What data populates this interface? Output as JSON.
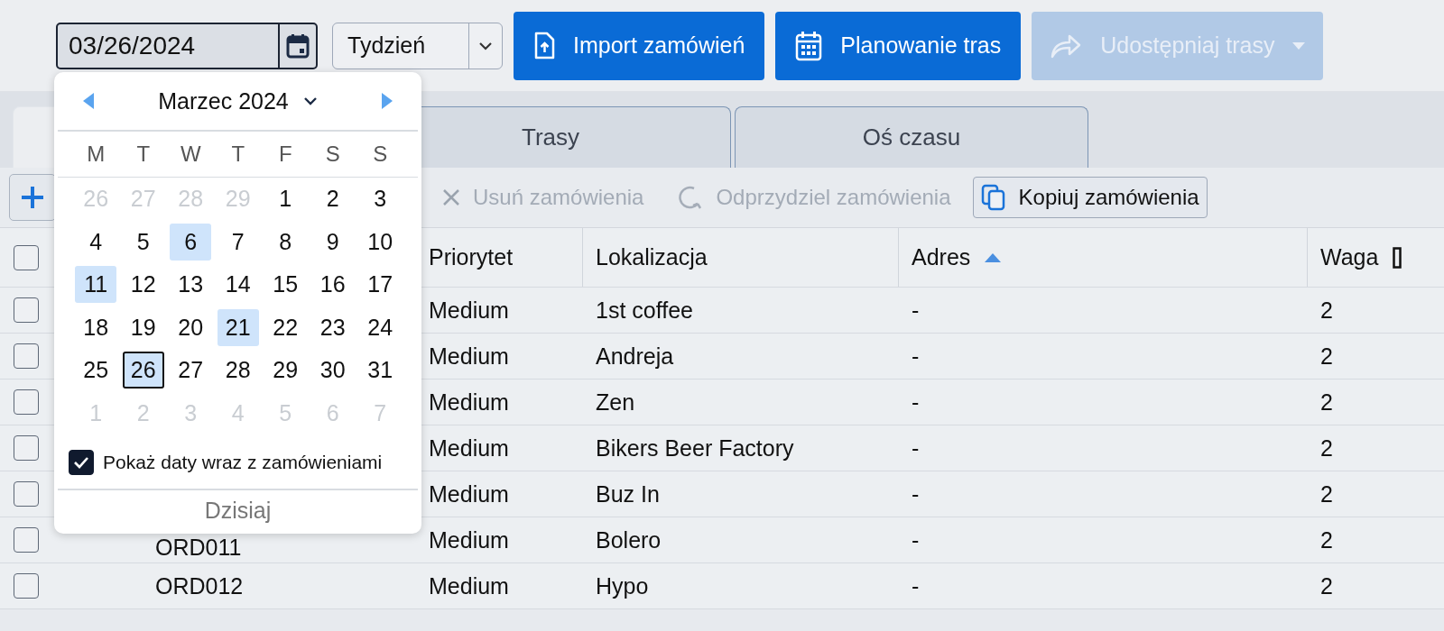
{
  "toolbar": {
    "date_field": {
      "value": "03/26/2024"
    },
    "period_select": {
      "value": "Tydzień"
    },
    "buttons": [
      {
        "label": "Import zamówień",
        "kind": "import",
        "disabled": false
      },
      {
        "label": "Planowanie tras",
        "kind": "plan",
        "disabled": false
      },
      {
        "label": "Udostępniaj trasy",
        "kind": "share",
        "disabled": true
      }
    ]
  },
  "tabs": [
    {
      "selected": true
    },
    {
      "label": "Trasy",
      "selected": false
    },
    {
      "label": "Oś czasu",
      "selected": false
    }
  ],
  "actions": [
    {
      "kind": "add",
      "disabled": false
    },
    {
      "label": "Usuń zamówienia",
      "kind": "delete",
      "disabled": true
    },
    {
      "label": "Odprzydziel zamówienia",
      "kind": "unassign",
      "disabled": true
    },
    {
      "label": "Kopiuj zamówienia",
      "kind": "copy",
      "disabled": false
    }
  ],
  "table": {
    "header_checkbox": {
      "checked": false
    },
    "columns": [
      {
        "label": "Priorytet"
      },
      {
        "label": "Lokalizacja"
      },
      {
        "label": "Adres",
        "sorted": true
      },
      {
        "label": "Waga",
        "unit_icon": true
      }
    ],
    "rows": [
      {
        "checked": false,
        "priority": "Medium",
        "location": "1st coffee",
        "address": "-",
        "weight": "2"
      },
      {
        "checked": false,
        "priority": "Medium",
        "location": "Andreja",
        "address": "-",
        "weight": "2"
      },
      {
        "checked": false,
        "priority": "Medium",
        "location": "Zen",
        "address": "-",
        "weight": "2"
      },
      {
        "checked": false,
        "priority": "Medium",
        "location": "Bikers Beer Factory",
        "address": "-",
        "weight": "2"
      },
      {
        "checked": false,
        "priority": "Medium",
        "location": "Buz In",
        "address": "-",
        "weight": "2"
      },
      {
        "checked": false,
        "id": "ORD011",
        "priority": "Medium",
        "location": "Bolero",
        "address": "-",
        "weight": "2"
      },
      {
        "checked": false,
        "id": "ORD012",
        "priority": "Medium",
        "location": "Hypo",
        "address": "-",
        "weight": "2"
      }
    ]
  },
  "datepicker": {
    "month": "Marzec 2024",
    "weekdays": [
      "M",
      "T",
      "W",
      "T",
      "F",
      "S",
      "S"
    ],
    "weeks": [
      [
        {
          "day": "26",
          "muted": true,
          "has_orders": false,
          "selected": false
        },
        {
          "day": "27",
          "muted": true,
          "has_orders": false,
          "selected": false
        },
        {
          "day": "28",
          "muted": true,
          "has_orders": false,
          "selected": false
        },
        {
          "day": "29",
          "muted": true,
          "has_orders": false,
          "selected": false
        },
        {
          "day": "1",
          "muted": false,
          "has_orders": false,
          "selected": false
        },
        {
          "day": "2",
          "muted": false,
          "has_orders": false,
          "selected": false
        },
        {
          "day": "3",
          "muted": false,
          "has_orders": false,
          "selected": false
        }
      ],
      [
        {
          "day": "4",
          "muted": false,
          "has_orders": false,
          "selected": false
        },
        {
          "day": "5",
          "muted": false,
          "has_orders": false,
          "selected": false
        },
        {
          "day": "6",
          "muted": false,
          "has_orders": true,
          "selected": false
        },
        {
          "day": "7",
          "muted": false,
          "has_orders": false,
          "selected": false
        },
        {
          "day": "8",
          "muted": false,
          "has_orders": false,
          "selected": false
        },
        {
          "day": "9",
          "muted": false,
          "has_orders": false,
          "selected": false
        },
        {
          "day": "10",
          "muted": false,
          "has_orders": false,
          "selected": false
        }
      ],
      [
        {
          "day": "11",
          "muted": false,
          "has_orders": true,
          "selected": false
        },
        {
          "day": "12",
          "muted": false,
          "has_orders": false,
          "selected": false
        },
        {
          "day": "13",
          "muted": false,
          "has_orders": false,
          "selected": false
        },
        {
          "day": "14",
          "muted": false,
          "has_orders": false,
          "selected": false
        },
        {
          "day": "15",
          "muted": false,
          "has_orders": false,
          "selected": false
        },
        {
          "day": "16",
          "muted": false,
          "has_orders": false,
          "selected": false
        },
        {
          "day": "17",
          "muted": false,
          "has_orders": false,
          "selected": false
        }
      ],
      [
        {
          "day": "18",
          "muted": false,
          "has_orders": false,
          "selected": false
        },
        {
          "day": "19",
          "muted": false,
          "has_orders": false,
          "selected": false
        },
        {
          "day": "20",
          "muted": false,
          "has_orders": false,
          "selected": false
        },
        {
          "day": "21",
          "muted": false,
          "has_orders": true,
          "selected": false
        },
        {
          "day": "22",
          "muted": false,
          "has_orders": false,
          "selected": false
        },
        {
          "day": "23",
          "muted": false,
          "has_orders": false,
          "selected": false
        },
        {
          "day": "24",
          "muted": false,
          "has_orders": false,
          "selected": false
        }
      ],
      [
        {
          "day": "25",
          "muted": false,
          "has_orders": false,
          "selected": false
        },
        {
          "day": "26",
          "muted": false,
          "has_orders": true,
          "selected": true
        },
        {
          "day": "27",
          "muted": false,
          "has_orders": false,
          "selected": false
        },
        {
          "day": "28",
          "muted": false,
          "has_orders": false,
          "selected": false
        },
        {
          "day": "29",
          "muted": false,
          "has_orders": false,
          "selected": false
        },
        {
          "day": "30",
          "muted": false,
          "has_orders": false,
          "selected": false
        },
        {
          "day": "31",
          "muted": false,
          "has_orders": false,
          "selected": false
        }
      ],
      [
        {
          "day": "1",
          "muted": true,
          "has_orders": false,
          "selected": false
        },
        {
          "day": "2",
          "muted": true,
          "has_orders": false,
          "selected": false
        },
        {
          "day": "3",
          "muted": true,
          "has_orders": false,
          "selected": false
        },
        {
          "day": "4",
          "muted": true,
          "has_orders": false,
          "selected": false
        },
        {
          "day": "5",
          "muted": true,
          "has_orders": false,
          "selected": false
        },
        {
          "day": "6",
          "muted": true,
          "has_orders": false,
          "selected": false
        },
        {
          "day": "7",
          "muted": true,
          "has_orders": false,
          "selected": false
        }
      ]
    ],
    "show_order_dates": {
      "label": "Pokaż daty wraz z zamówieniami",
      "checked": true
    },
    "today_button": "Dzisiaj"
  }
}
